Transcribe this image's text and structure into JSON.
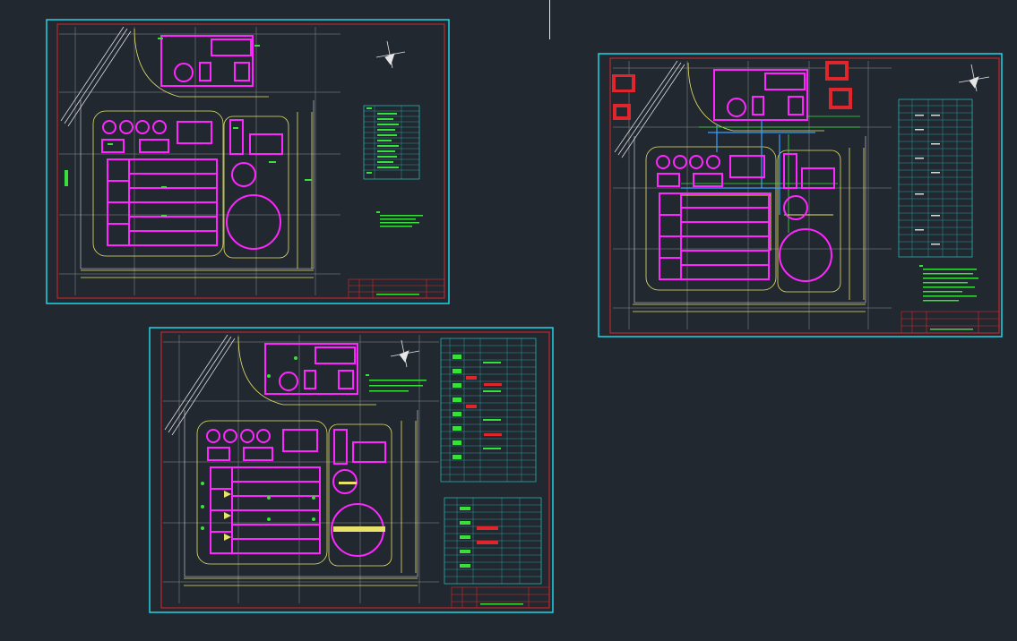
{
  "app": {
    "background": "#212830",
    "colors": {
      "viewport_border": "#21d4e6",
      "frame_border": "#e0262c",
      "building": "#ff26ff",
      "road": "#e8e26a",
      "grid": "#b8b8b8",
      "pipe": "#3ae03a",
      "water_line": "#3aa0ff",
      "table_line": "#2ae0e0",
      "highlight": "#ff1f1f"
    }
  },
  "sheets": [
    {
      "id": "sheet-1",
      "has_legend_table": true,
      "has_notes": true,
      "has_title_block": true
    },
    {
      "id": "sheet-2",
      "has_legend_table": true,
      "has_notes": true,
      "has_title_block": true
    },
    {
      "id": "sheet-3",
      "has_legend_table": true,
      "has_notes": true,
      "has_title_block": true
    }
  ],
  "icons": {
    "north_arrow": "north-arrow-icon",
    "crosshair": "crosshair-cursor-icon"
  }
}
